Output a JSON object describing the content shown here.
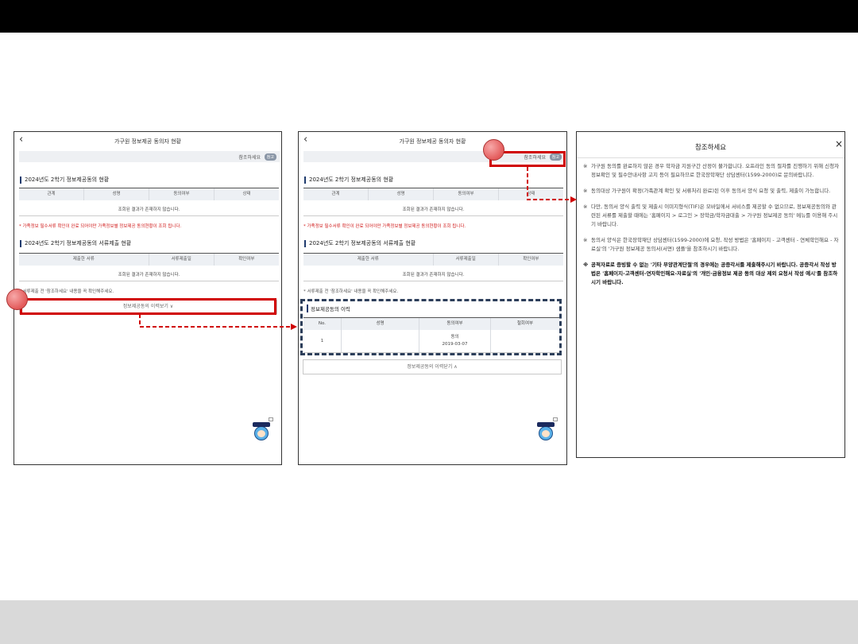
{
  "screen_title": "가구원 정보제공 동의자 현황",
  "ref_label": "참조하세요",
  "ref_badge": "참고",
  "section1_title": "2024년도 2학기 정보제공동의 현황",
  "table1_headers": [
    "관계",
    "성명",
    "동의여부",
    "상태"
  ],
  "empty_msg": "조회된 결과가 존재하지 않습니다.",
  "red_note": "* 가족정보 필수서류 확인이 완료 되어야만 가족정보별 정보제공 동의현황이 조회 됩니다.",
  "section2_title": "2024년도 2학기 정보제공동의 서류제출 현황",
  "table2_headers": [
    "제출한 서류",
    "서류제출일",
    "확인여부"
  ],
  "gray_note": "* 서류제출 전 '참조하세요' 내용을 꼭 확인해주세요.",
  "history_open_btn": "정보제공동의 이력보기 ∨",
  "history_title": "정보제공동의 이력",
  "history_headers": [
    "No.",
    "성명",
    "동의여부",
    "철회여부"
  ],
  "history_row": {
    "no": "1",
    "name": "",
    "consent": "동의",
    "date": "2019-03-07",
    "withdraw": ""
  },
  "history_close_btn": "정보제공동의 이력닫기 ∧",
  "notice": {
    "title": "참조하세요",
    "close_icon": "×",
    "items": [
      "가구원 동의를 완료하지 않은 경우 학자금 지원구간 산정이 불가합니다. 오프라인 동의 절차를 진행하기 위해 신청자 정보확인 및 필수안내사항 고지 등이 필요하므로 한국장학재단 상담센터(1599-2000)로 문의바랍니다.",
      "동의대상 가구원이 확정(가족관계 확인 및 서류처리 완료)된 이후 동의서 양식 요청 및 출력, 제출이 가능합니다.",
      "다만, 동의서 양식 출력 및 제출시 이미지형식(TIF)은 모바일에서 서비스를 제공할 수 없으므로, 정보제공동의와 관련된 서류를 제출할 때에는 '홈페이지 > 로그인 > 장학금/학자금대출 > 가구원 정보제공 동의' 메뉴를 이용해 주시기 바랍니다.",
      "동의서 양식은 한국장학재단 상담센터(1599-2000)에 요청, 작성 방법은 '홈페이지 - 고객센터 - 연체학인해요 - 자료실'의 '가구원 정보제공 동의서(서면) 샘플'을 참조하시기 바랍니다.",
      "공적자료로 증빙할 수 없는 '기타 부양관계단절'의 경우에는 공증각서를 제출해주시기 바랍니다. 공증각서 작성 방법은 '홈페이지-고객센터-연자학인해요-자료실'의 '개인·금융정보 제공 동의 대상 제외 요청서 작성 예시'를 참조하시기 바랍니다."
    ],
    "mark": "※"
  },
  "icons": {
    "back": "chevron-left-icon",
    "close": "close-icon",
    "mascot": "mascot-icon"
  },
  "colors": {
    "highlight": "#d00000",
    "dashed_box": "#2c3e5a",
    "accent": "#1f3b6e"
  }
}
